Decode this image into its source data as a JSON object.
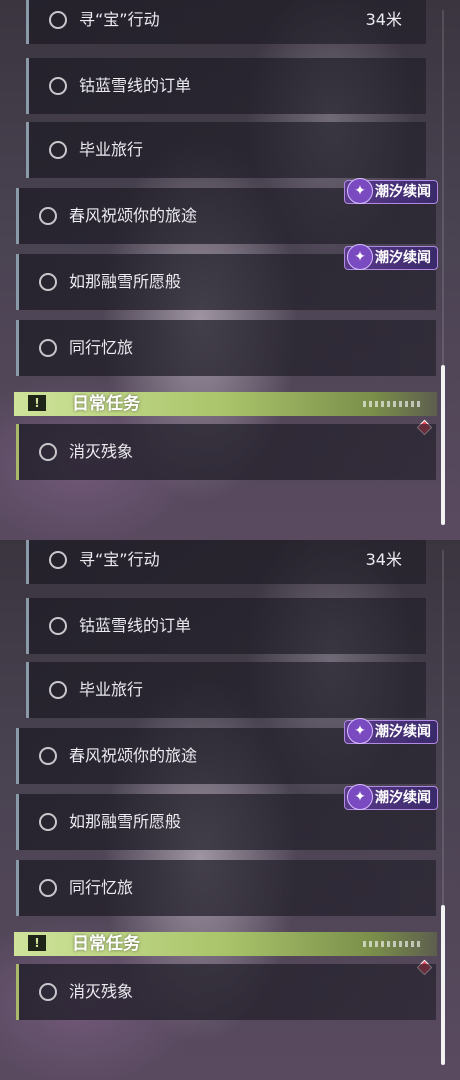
{
  "quests": [
    {
      "label": "寻“宝”行动",
      "distance": "34米"
    },
    {
      "label": "钴蓝雪线的订单"
    },
    {
      "label": "毕业旅行"
    },
    {
      "label": "春风祝颂你的旅途",
      "badge": "潮汐续闻"
    },
    {
      "label": "如那融雪所愿般",
      "badge": "潮汐续闻"
    },
    {
      "label": "同行忆旅"
    }
  ],
  "daily": {
    "header": "日常任务",
    "icon": "!",
    "items": [
      {
        "label": "消灭残象"
      }
    ]
  },
  "badge_icon": "✦",
  "colors": {
    "daily_accent": "#cfe39a",
    "badge_bg": "#5a3a8a",
    "marker": "#e0445a"
  }
}
